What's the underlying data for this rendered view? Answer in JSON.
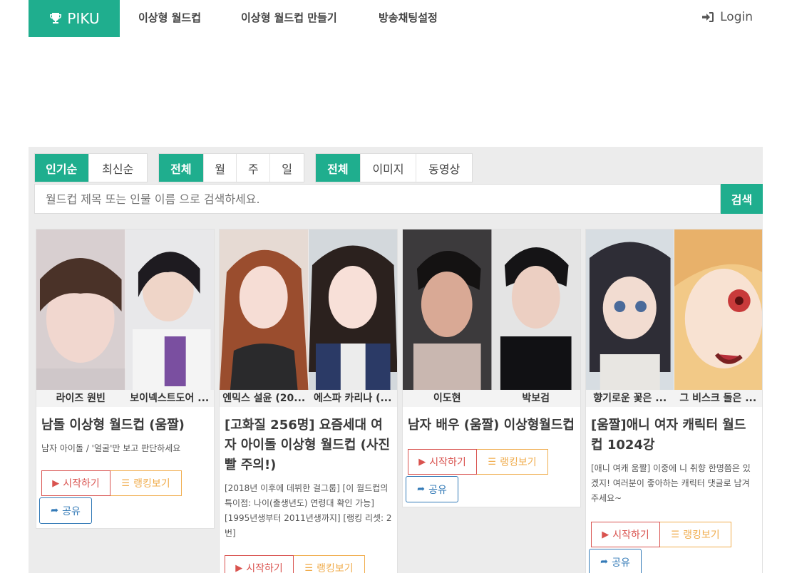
{
  "nav": {
    "brand": "PIKU",
    "links": [
      "이상형 월드컵",
      "이상형 월드컵 만들기",
      "방송채팅설정"
    ],
    "login": "Login"
  },
  "filters": {
    "sort": [
      "인기순",
      "최신순"
    ],
    "period": [
      "전체",
      "월",
      "주",
      "일"
    ],
    "media": [
      "전체",
      "이미지",
      "동영상"
    ]
  },
  "search": {
    "placeholder": "월드컵 제목 또는 인물 이름 으로 검색하세요.",
    "button": "검색"
  },
  "buttons": {
    "start": "시작하기",
    "ranking": "랭킹보기",
    "share": "공유"
  },
  "cards": [
    {
      "left_name": "라이즈 원빈",
      "right_name": "보이넥스트도어 ...",
      "title": "남돌 이상형 월드컵 (움짤)",
      "desc": "남자 아이돌 / '얼굴'만 보고 판단하세요"
    },
    {
      "left_name": "엔믹스 설윤 (20...",
      "right_name": "에스파 카리나 (...",
      "title": "[고화질 256명] 요즘세대 여자 아이돌 이상형 월드컵 (사진빨 주의!)",
      "desc": "[2018년 이후에 데뷔한 걸그룹] [이 월드컵의 특이점: 나이(출생년도) 연령대 확인 가능] [1995년생부터 2011년생까지] [랭킹 리셋: 2번]"
    },
    {
      "left_name": "이도현",
      "right_name": "박보검",
      "title": "남자 배우 (움짤) 이상형월드컵",
      "desc": ""
    },
    {
      "left_name": "향기로운 꽃은 ...",
      "right_name": "그 비스크 돌은 ...",
      "title": "[움짤]애니 여자 캐릭터 월드컵 1024강",
      "desc": "[애니 여캐 움짤] 이중에 니 취향 한명쯤은 있겠지!   여러분이 좋아하는 캐릭터 댓글로 남겨주세요~"
    }
  ]
}
